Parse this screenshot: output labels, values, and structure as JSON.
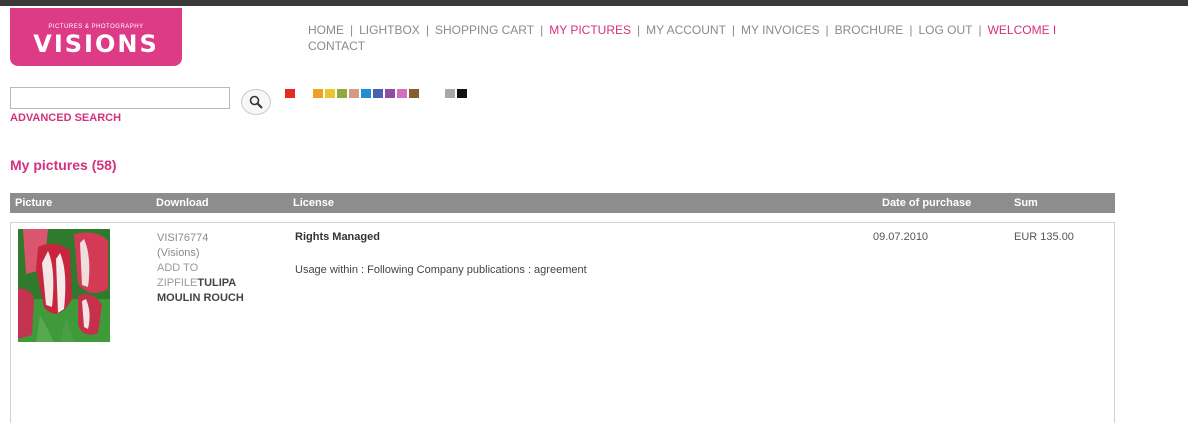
{
  "logo": {
    "tagline": "Pictures & Photography",
    "name": "VISIONS"
  },
  "nav": {
    "items": [
      {
        "label": "HOME",
        "active": false
      },
      {
        "label": "LIGHTBOX",
        "active": false
      },
      {
        "label": "SHOPPING CART",
        "active": false
      },
      {
        "label": "MY PICTURES",
        "active": true
      },
      {
        "label": "MY ACCOUNT",
        "active": false
      },
      {
        "label": "MY INVOICES",
        "active": false
      },
      {
        "label": "BROCHURE",
        "active": false
      },
      {
        "label": "LOG OUT",
        "active": false
      },
      {
        "label": "WELCOME I",
        "active": false
      },
      {
        "label": "CONTACT",
        "active": false
      }
    ],
    "separator": "|"
  },
  "search": {
    "value": "",
    "placeholder": "",
    "advanced_label": "ADVANCED SEARCH",
    "swatch_colors": [
      "#e32b1f",
      "#f0a020",
      "#e8c830",
      "#8eaa3f",
      "#d49a86",
      "#1f8fd0",
      "#4a5fb0",
      "#8a4fa0",
      "#d46ec0",
      "#8a5a30",
      "#a8a8a8",
      "#111111"
    ]
  },
  "page": {
    "title": "My pictures (58)"
  },
  "table": {
    "headers": {
      "picture": "Picture",
      "download": "Download",
      "license": "License",
      "date": "Date of purchase",
      "sum": "Sum"
    },
    "rows": [
      {
        "image_id": "VISI76774",
        "credit": "(Visions)",
        "add_to": "ADD TO",
        "zipfile": "ZIPFILE",
        "title_line1": "TULIPA",
        "title_line2": "MOULIN ROUCH",
        "license_type": "Rights Managed",
        "usage": "Usage within : Following Company publications : agreement",
        "date": "09.07.2010",
        "sum": "EUR  135.00"
      }
    ]
  },
  "colors": {
    "brand": "#de3b87",
    "accent_text": "#d4317e",
    "header_bar": "#8d8d8d"
  }
}
